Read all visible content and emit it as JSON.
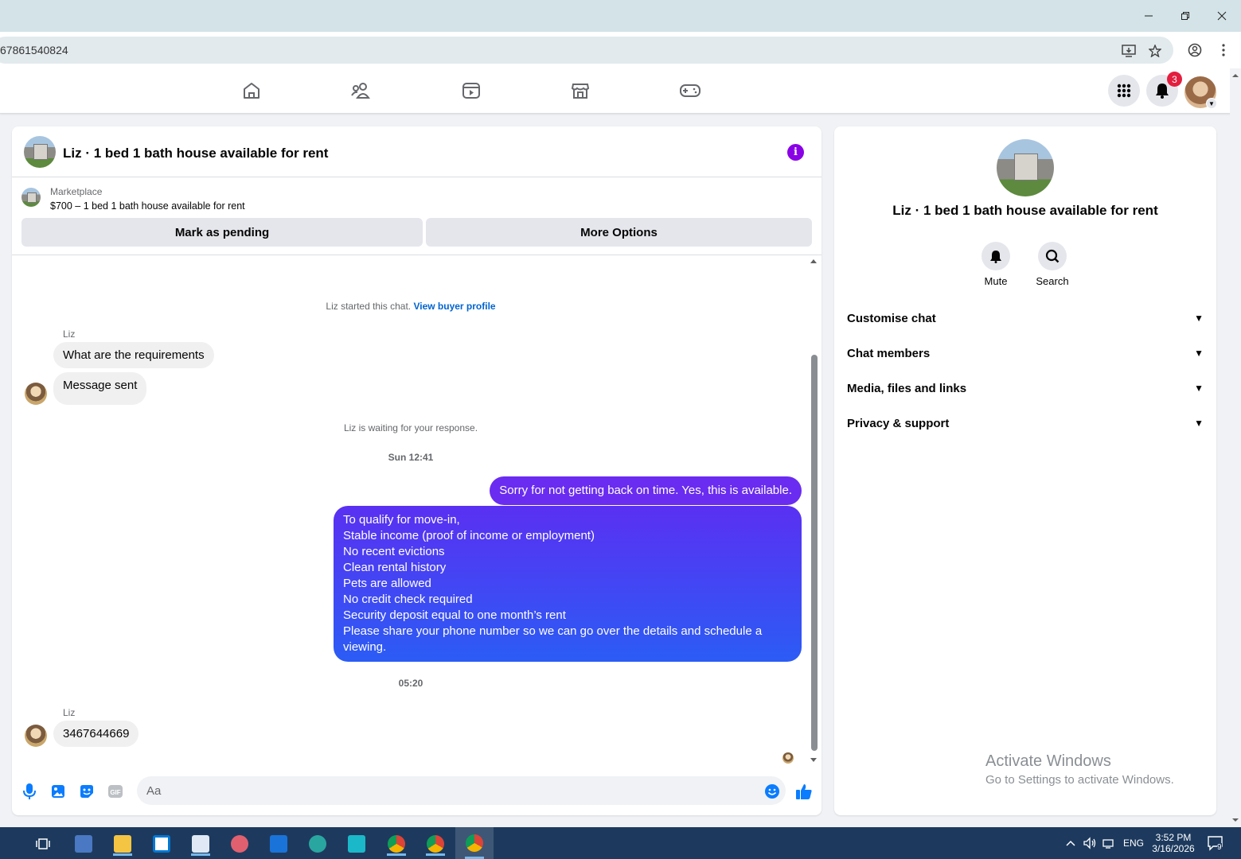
{
  "browser": {
    "url_fragment": "67861540824"
  },
  "chat": {
    "title": "Liz · 1 bed 1 bath house available for rent",
    "listing_label": "Marketplace",
    "listing_text": "$700 – 1 bed 1 bath house available for rent",
    "mark_pending": "Mark as pending",
    "more_options": "More Options",
    "started_text": "Liz started this chat.",
    "view_buyer": "View buyer profile",
    "sender1": "Liz",
    "msg1": "What are the requirements",
    "msg2": "Message sent",
    "waiting": "Liz is waiting for your response.",
    "ts1": "Sun 12:41",
    "out1": "Sorry for not getting back on time. Yes, this is available.",
    "out2_lines": [
      "To qualify for move-in,",
      "Stable income (proof of income or employment)",
      "No recent evictions",
      "Clean rental history",
      "Pets are allowed",
      "No credit check required",
      "Security deposit equal to one month’s rent",
      "Please share your phone number so we can go over the details and schedule a",
      "viewing."
    ],
    "ts2": "05:20",
    "sender2": "Liz",
    "msg3": "3467644669",
    "composer_placeholder": "Aa"
  },
  "nav": {
    "notification_count": "3"
  },
  "info": {
    "title": "Liz · 1 bed 1 bath house available for rent",
    "mute": "Mute",
    "search": "Search",
    "sections": [
      "Customise chat",
      "Chat members",
      "Media, files and links",
      "Privacy & support"
    ]
  },
  "watermark": {
    "title": "Activate Windows",
    "subtitle": "Go to Settings to activate Windows."
  },
  "taskbar": {
    "time": "3:52 PM",
    "date": "3/16/2026",
    "lang": "ENG",
    "notif_count": "9"
  },
  "colors": {
    "accent_purple": "#8a01e6",
    "bubble_gradient_top": "#6a2cf0",
    "bubble_gradient_bottom": "#2b5cf5",
    "like_blue": "#0a7cff"
  }
}
